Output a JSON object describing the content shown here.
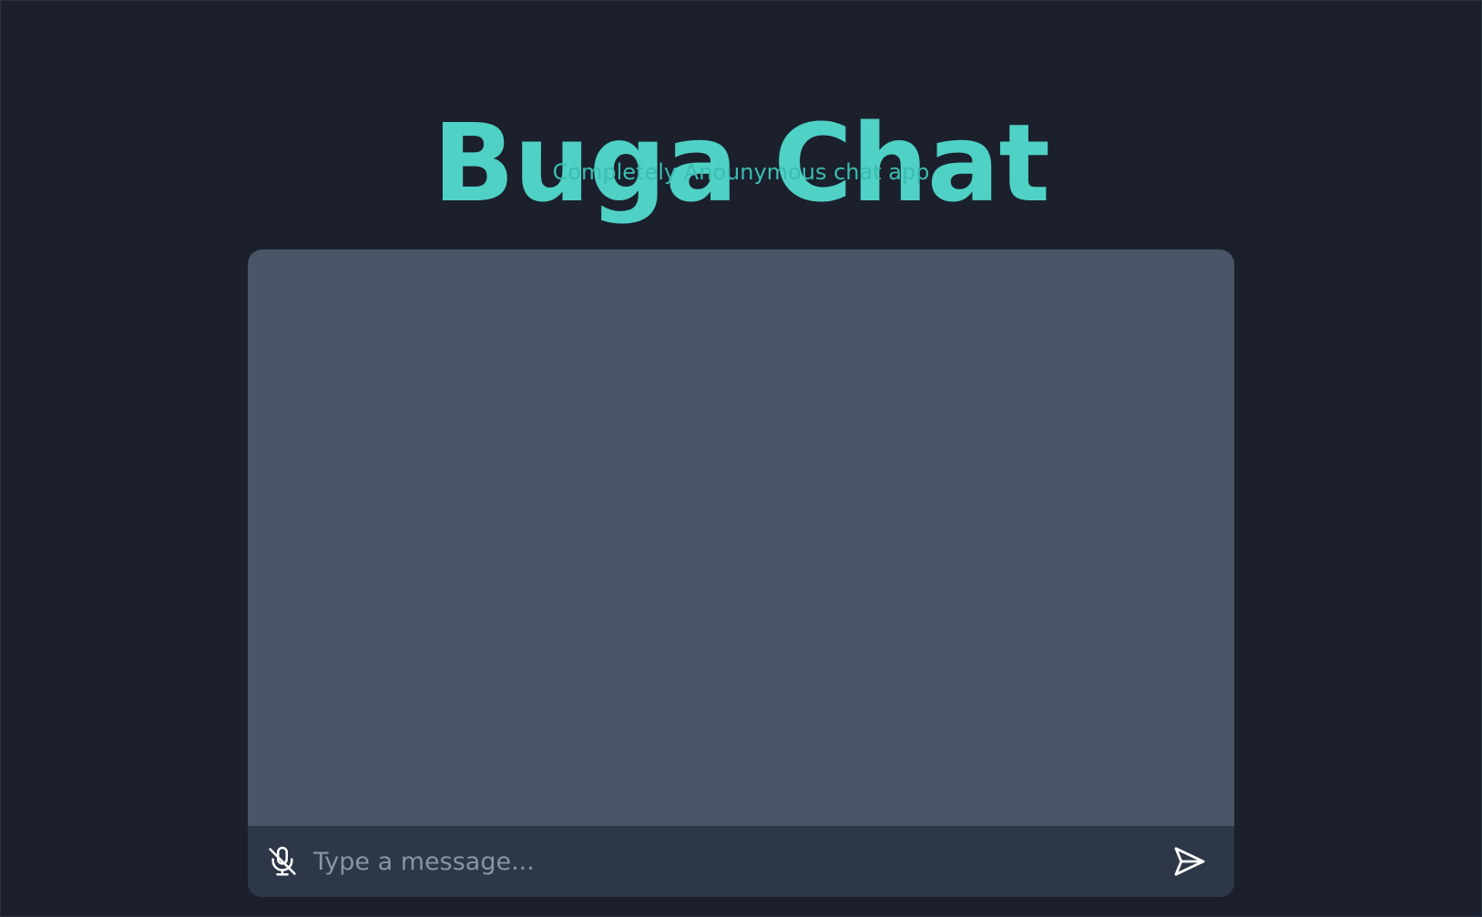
{
  "header": {
    "title": "Buga Chat",
    "subtitle": "Completely Anounymous chat app"
  },
  "chat": {
    "messages": [],
    "input_placeholder": "Type a message...",
    "input_value": "",
    "mic_icon": "microphone-off-icon",
    "send_icon": "send-icon"
  },
  "colors": {
    "background": "#1b202c",
    "accent": "#4fd1c5",
    "panel": "#4a5568",
    "composer": "#2d3748"
  }
}
